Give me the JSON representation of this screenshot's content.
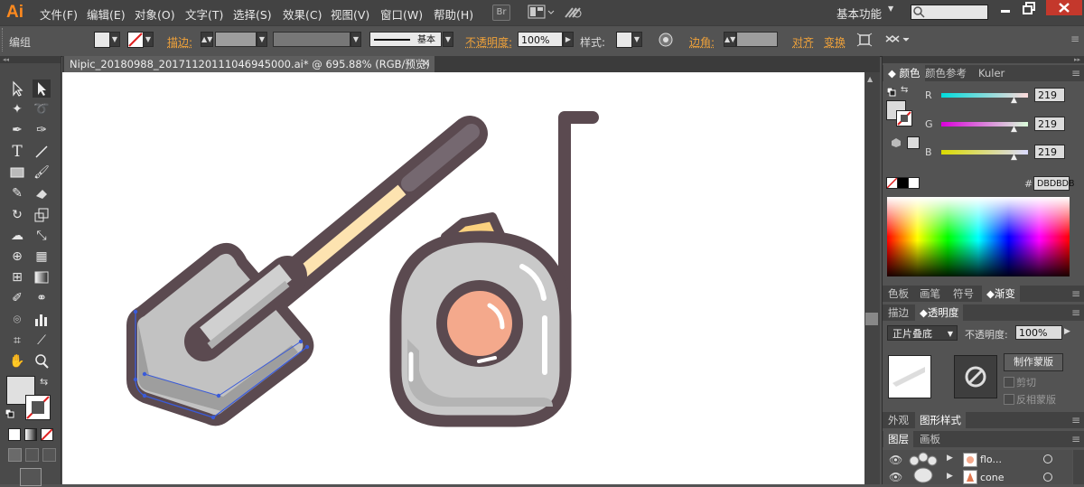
{
  "app": {
    "logo": "Ai",
    "workspace": "基本功能"
  },
  "menu": [
    "文件(F)",
    "编辑(E)",
    "对象(O)",
    "文字(T)",
    "选择(S)",
    "效果(C)",
    "视图(V)",
    "窗口(W)",
    "帮助(H)"
  ],
  "menu_icons": {
    "bridge": "Br"
  },
  "control": {
    "selection_label": "编组",
    "stroke_label": "描边:",
    "stroke_style": "基本",
    "opacity_label": "不透明度:",
    "opacity_value": "100%",
    "style_label": "样式:",
    "corner_label": "边角:",
    "align_label": "对齐",
    "transform_label": "变换"
  },
  "document": {
    "tab_title": "Nipic_20180988_20171120111046945000.ai* @ 695.88% (RGB/预览)",
    "close": "×"
  },
  "color_panel": {
    "tabs": [
      "颜色",
      "颜色参考",
      "Kuler"
    ],
    "channels": [
      {
        "label": "R",
        "value": "219"
      },
      {
        "label": "G",
        "value": "219"
      },
      {
        "label": "B",
        "value": "219"
      }
    ],
    "hex_label": "#",
    "hex_value": "DBDBDB"
  },
  "panel_tabs_2": [
    "色板",
    "画笔",
    "符号",
    "渐变"
  ],
  "transparency_panel": {
    "tabs": [
      "描边",
      "透明度"
    ],
    "blend_mode": "正片叠底",
    "opacity_label": "不透明度:",
    "opacity_value": "100%",
    "make_mask": "制作蒙版",
    "clip": "剪切",
    "invert": "反相蒙版"
  },
  "panel_tabs_3": [
    "外观",
    "图形样式"
  ],
  "layers_panel": {
    "tabs": [
      "图层",
      "画板"
    ],
    "layers": [
      {
        "name": "flo..."
      },
      {
        "name": "cone"
      }
    ]
  },
  "colors": {
    "accent_orange": "#f0a23a",
    "artwork_outline": "#5b4a50",
    "shovel_gray": "#c8c8c8",
    "handle_cream": "#fde3b0",
    "tape_peach": "#f4a98c",
    "selection_blue": "#3a5bd9"
  }
}
